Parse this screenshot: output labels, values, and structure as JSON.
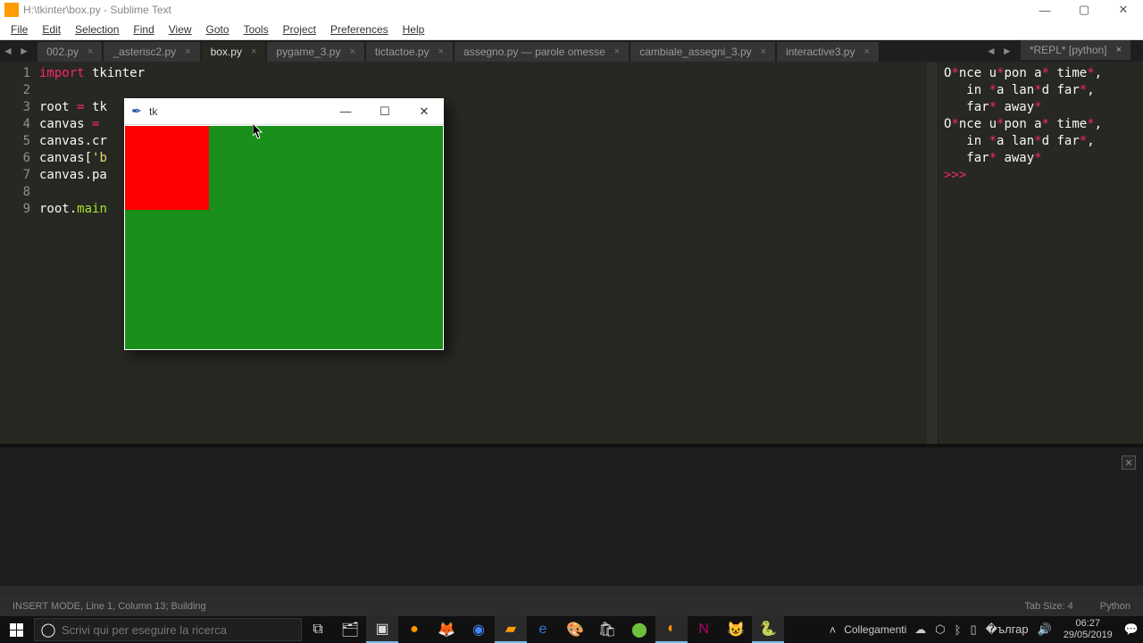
{
  "window": {
    "title": "H:\\tkinter\\box.py - Sublime Text",
    "min": "—",
    "max": "▢",
    "close": "✕"
  },
  "menu": [
    "File",
    "Edit",
    "Selection",
    "Find",
    "View",
    "Goto",
    "Tools",
    "Project",
    "Preferences",
    "Help"
  ],
  "nav": {
    "back": "◄",
    "fwd": "►"
  },
  "tabs": [
    {
      "label": "002.py",
      "dirty": false
    },
    {
      "label": "_asterisc2.py",
      "dirty": false
    },
    {
      "label": "box.py",
      "dirty": false,
      "active": true
    },
    {
      "label": "pygame_3.py",
      "dirty": false
    },
    {
      "label": "tictactoe.py",
      "dirty": false
    },
    {
      "label": "assegno.py — parole omesse",
      "dirty": false
    },
    {
      "label": "cambiale_assegni_3.py",
      "dirty": false
    },
    {
      "label": "interactive3.py",
      "dirty": false
    }
  ],
  "right_tab": {
    "label": "*REPL* [python]",
    "dirty": true
  },
  "gutter": [
    "1",
    "2",
    "3",
    "4",
    "5",
    "6",
    "7",
    "8",
    "9"
  ],
  "code": {
    "l1a": "import",
    "l1b": " tkinter",
    "l3a": "root ",
    "l3b": "=",
    "l3c": " tk",
    "l4a": "canvas ",
    "l4b": "=",
    "l5": "canvas.cr",
    "l6": "canvas[",
    "l6b": "'b",
    "l7": "canvas.pa",
    "l9a": "root.",
    "l9b": "main"
  },
  "repl": {
    "r1a": "O",
    "r1b": "*",
    "r1c": "nce u",
    "r1d": "*",
    "r1e": "pon a",
    "r1f": "*",
    "r1g": " time",
    "r1h": "*",
    "r1i": ",",
    "r2a": "   in ",
    "r2b": "*",
    "r2c": "a lan",
    "r2d": "*",
    "r2e": "d far",
    "r2f": "*",
    "r2g": ",",
    "r3a": "   far",
    "r3b": "*",
    "r3c": " away",
    "r3d": "*",
    "r4a": "O",
    "r4b": "*",
    "r4c": "nce u",
    "r4d": "*",
    "r4e": "pon a",
    "r4f": "*",
    "r4g": " time",
    "r4h": "*",
    "r4i": ",",
    "r5a": "   in ",
    "r5b": "*",
    "r5c": "a lan",
    "r5d": "*",
    "r5e": "d far",
    "r5f": "*",
    "r5g": ",",
    "r6a": "   far",
    "r6b": "*",
    "r6c": " away",
    "r6d": "*",
    "prompt": ">>> "
  },
  "status": {
    "left": "INSERT MODE, Line 1, Column 13; Building",
    "tabsize": "Tab Size: 4",
    "syntax": "Python"
  },
  "closepanel": "✕",
  "tk": {
    "title": "tk",
    "min": "—",
    "max": "☐",
    "close": "✕"
  },
  "taskbar": {
    "search_ph": "Scrivi qui per eseguire la ricerca",
    "collegamenti": "Collegamenti",
    "time": "06:27",
    "date": "29/05/2019"
  }
}
